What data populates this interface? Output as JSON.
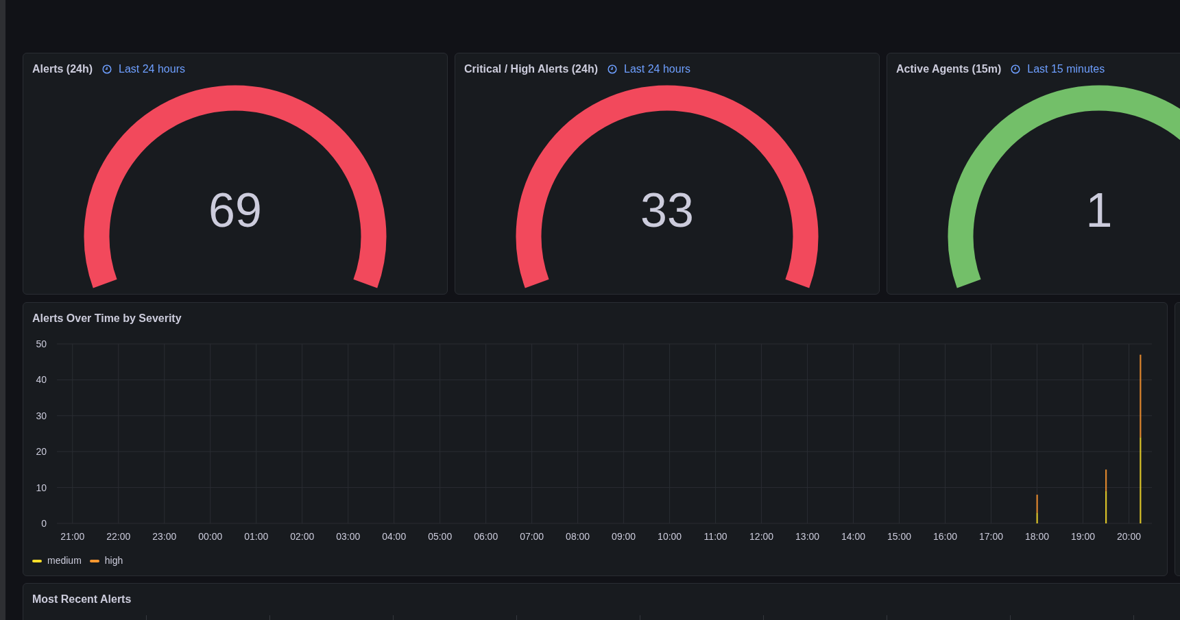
{
  "gauge_panels": [
    {
      "kind": "gauge",
      "title": "Alerts (24h)",
      "time_range": "Last 24 hours",
      "value": "69",
      "color": "#f2495c"
    },
    {
      "kind": "gauge",
      "title": "Critical / High Alerts (24h)",
      "time_range": "Last 24 hours",
      "value": "33",
      "color": "#f2495c"
    },
    {
      "kind": "gauge",
      "title": "Active Agents (15m)",
      "time_range": "Last 15 minutes",
      "value": "1",
      "color": "#73bf69"
    }
  ],
  "chart_panel": {
    "title": "Alerts Over Time by Severity",
    "chart_data": {
      "type": "bar",
      "stacked": true,
      "categories": [
        "21:00",
        null,
        null,
        null,
        "22:00",
        null,
        null,
        null,
        "23:00",
        null,
        null,
        null,
        "00:00",
        null,
        null,
        null,
        "01:00",
        null,
        null,
        null,
        "02:00",
        null,
        null,
        null,
        "03:00",
        null,
        null,
        null,
        "04:00",
        null,
        null,
        null,
        "05:00",
        null,
        null,
        null,
        "06:00",
        null,
        null,
        null,
        "07:00",
        null,
        null,
        null,
        "08:00",
        null,
        null,
        null,
        "09:00",
        null,
        null,
        null,
        "10:00",
        null,
        null,
        null,
        "11:00",
        null,
        null,
        null,
        "12:00",
        null,
        null,
        null,
        "13:00",
        null,
        null,
        null,
        "14:00",
        null,
        null,
        null,
        "15:00",
        null,
        null,
        null,
        "16:00",
        null,
        null,
        null,
        "17:00",
        null,
        null,
        null,
        "18:00",
        null,
        null,
        null,
        "19:00",
        null,
        null,
        null,
        "20:00",
        null
      ],
      "series": [
        {
          "name": "medium",
          "color": "#fade2a",
          "values": [
            null,
            null,
            null,
            null,
            null,
            null,
            null,
            null,
            null,
            null,
            null,
            null,
            null,
            null,
            null,
            null,
            null,
            null,
            null,
            null,
            null,
            null,
            null,
            null,
            null,
            null,
            null,
            null,
            null,
            null,
            null,
            null,
            null,
            null,
            null,
            null,
            null,
            null,
            null,
            null,
            null,
            null,
            null,
            null,
            null,
            null,
            null,
            null,
            null,
            null,
            null,
            null,
            null,
            null,
            null,
            null,
            null,
            null,
            null,
            null,
            null,
            null,
            null,
            null,
            null,
            null,
            null,
            null,
            null,
            null,
            null,
            null,
            null,
            null,
            null,
            null,
            null,
            null,
            null,
            null,
            null,
            null,
            null,
            null,
            3,
            null,
            null,
            null,
            null,
            null,
            9,
            null,
            null,
            24
          ]
        },
        {
          "name": "high",
          "color": "#ff9830",
          "values": [
            null,
            null,
            null,
            null,
            null,
            null,
            null,
            null,
            null,
            null,
            null,
            null,
            null,
            null,
            null,
            null,
            null,
            null,
            null,
            null,
            null,
            null,
            null,
            null,
            null,
            null,
            null,
            null,
            null,
            null,
            null,
            null,
            null,
            null,
            null,
            null,
            null,
            null,
            null,
            null,
            null,
            null,
            null,
            null,
            null,
            null,
            null,
            null,
            null,
            null,
            null,
            null,
            null,
            null,
            null,
            null,
            null,
            null,
            null,
            null,
            null,
            null,
            null,
            null,
            null,
            null,
            null,
            null,
            null,
            null,
            null,
            null,
            null,
            null,
            null,
            null,
            null,
            null,
            null,
            null,
            null,
            null,
            null,
            null,
            5,
            null,
            null,
            null,
            null,
            null,
            6,
            null,
            null,
            23
          ]
        }
      ],
      "grid": true,
      "ylim": [
        0,
        50
      ],
      "yticks": [
        0,
        10,
        20,
        30,
        40,
        50
      ]
    }
  },
  "table_panel": {
    "title": "Most Recent Alerts"
  }
}
